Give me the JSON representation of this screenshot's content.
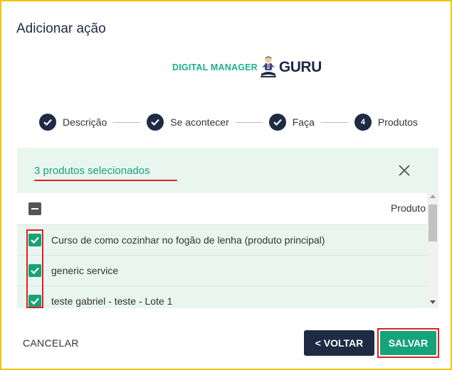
{
  "dialog": {
    "title": "Adicionar ação"
  },
  "logo": {
    "left_text": "DIGITAL MANAGER",
    "right_text": "GURU"
  },
  "stepper": {
    "steps": [
      {
        "label": "Descrição",
        "state": "done"
      },
      {
        "label": "Se acontecer",
        "state": "done"
      },
      {
        "label": "Faça",
        "state": "done"
      },
      {
        "label": "Produtos",
        "state": "active",
        "number": "4"
      }
    ]
  },
  "selection": {
    "summary": "3 produtos selecionados"
  },
  "table": {
    "column_header": "Produto",
    "rows": [
      {
        "name": "Curso de como cozinhar no fogão de lenha (produto principal)",
        "checked": true
      },
      {
        "name": "generic service",
        "checked": true
      },
      {
        "name": "teste gabriel - teste - Lote 1",
        "checked": true
      }
    ]
  },
  "actions": {
    "cancel": "CANCELAR",
    "back": "< VOLTAR",
    "save": "SALVAR"
  },
  "colors": {
    "accent_green": "#15a37a",
    "navy": "#1f2a44",
    "highlight_red": "#e02020",
    "frame_yellow": "#f2c500",
    "panel_bg": "#e9f6f0"
  }
}
